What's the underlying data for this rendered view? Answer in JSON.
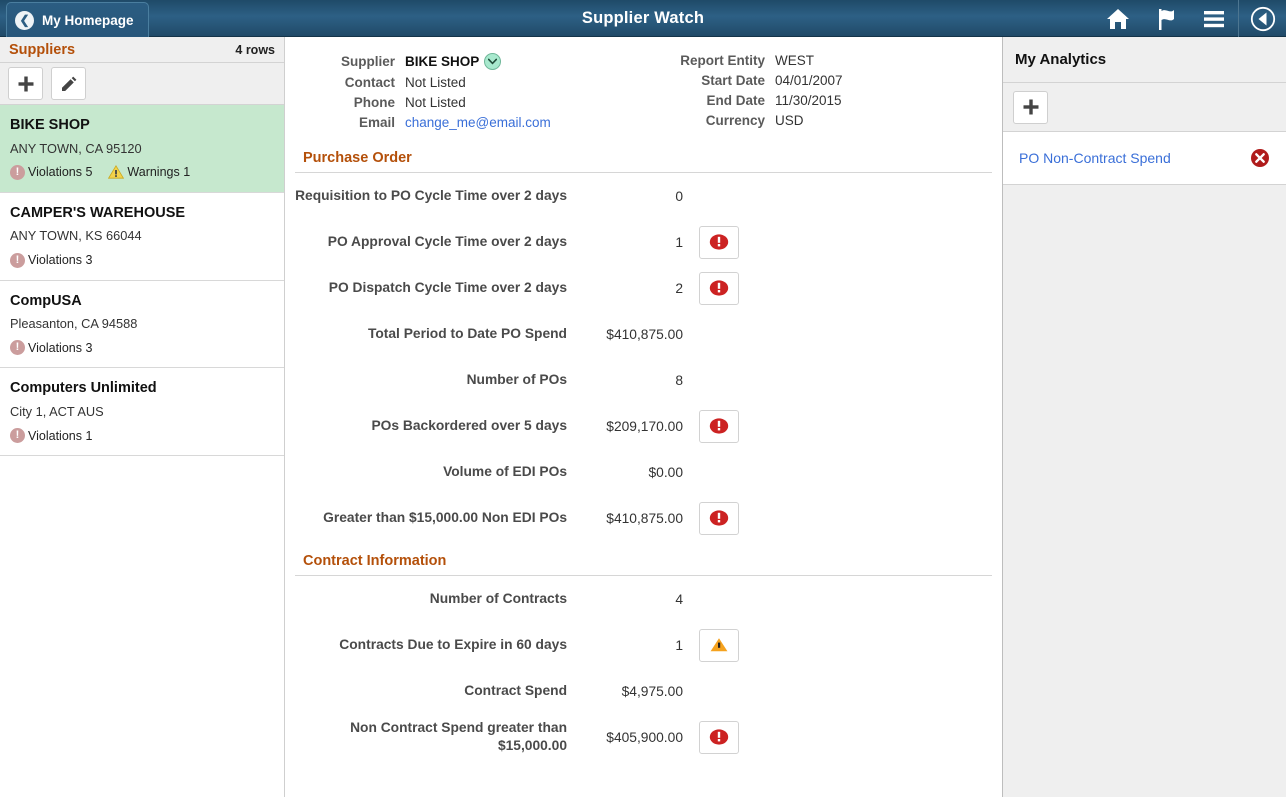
{
  "topbar": {
    "back_label": "My Homepage",
    "back_icon": "chevron-left-icon",
    "title": "Supplier Watch",
    "icons": [
      {
        "name": "home-icon",
        "label": "Home"
      },
      {
        "name": "flag-icon",
        "label": "Notifications"
      },
      {
        "name": "hamburger-menu-icon",
        "label": "Actions Menu"
      },
      {
        "name": "nav-compass-icon",
        "label": "Navigator"
      }
    ]
  },
  "sidebar": {
    "title": "Suppliers",
    "row_count": "4 rows",
    "toolbar": {
      "add_label": "Add",
      "add_icon": "plus-icon",
      "edit_label": "Edit",
      "edit_icon": "pencil-icon"
    },
    "items": [
      {
        "name": "BIKE SHOP",
        "address": "ANY TOWN, CA  95120",
        "violations_label": "Violations 5",
        "warnings_label": "Warnings 1",
        "selected": true
      },
      {
        "name": "CAMPER'S WAREHOUSE",
        "address": "ANY TOWN, KS  66044",
        "violations_label": "Violations 3",
        "warnings_label": "",
        "selected": false
      },
      {
        "name": "CompUSA",
        "address": "Pleasanton, CA  94588",
        "violations_label": "Violations 3",
        "warnings_label": "",
        "selected": false
      },
      {
        "name": "Computers Unlimited",
        "address": "City 1, ACT  AUS",
        "violations_label": "Violations 1",
        "warnings_label": "",
        "selected": false
      }
    ]
  },
  "main": {
    "header_left": [
      {
        "label": "Supplier",
        "value": "BIKE SHOP",
        "has_dropdown": true
      },
      {
        "label": "Contact",
        "value": "Not Listed",
        "has_dropdown": false
      },
      {
        "label": "Phone",
        "value": "Not Listed",
        "has_dropdown": false
      },
      {
        "label": "Email",
        "value": "change_me@email.com",
        "has_dropdown": false,
        "is_link": true
      }
    ],
    "header_right": [
      {
        "label": "Report Entity",
        "value": "WEST"
      },
      {
        "label": "Start Date",
        "value": "04/01/2007"
      },
      {
        "label": "End Date",
        "value": "11/30/2015"
      },
      {
        "label": "Currency",
        "value": "USD"
      }
    ],
    "sections": [
      {
        "title": "Purchase Order",
        "metrics": [
          {
            "label": "Requisition to PO Cycle Time over 2 days",
            "value": "0",
            "alert": "none"
          },
          {
            "label": "PO Approval Cycle Time over 2 days",
            "value": "1",
            "alert": "error"
          },
          {
            "label": "PO Dispatch Cycle Time over 2 days",
            "value": "2",
            "alert": "error"
          },
          {
            "label": "Total Period to Date PO Spend",
            "value": "$410,875.00",
            "alert": "none"
          },
          {
            "label": "Number of POs",
            "value": "8",
            "alert": "none"
          },
          {
            "label": "POs Backordered over 5 days",
            "value": "$209,170.00",
            "alert": "error"
          },
          {
            "label": "Volume of EDI POs",
            "value": "$0.00",
            "alert": "none"
          },
          {
            "label": "Greater than $15,000.00 Non EDI POs",
            "value": "$410,875.00",
            "alert": "error"
          }
        ]
      },
      {
        "title": "Contract Information",
        "metrics": [
          {
            "label": "Number of Contracts",
            "value": "4",
            "alert": "none"
          },
          {
            "label": "Contracts Due to Expire in 60 days",
            "value": "1",
            "alert": "warning"
          },
          {
            "label": "Contract Spend",
            "value": "$4,975.00",
            "alert": "none"
          },
          {
            "label": "Non Contract Spend greater than $15,000.00",
            "value": "$405,900.00",
            "alert": "error"
          }
        ]
      }
    ]
  },
  "right_panel": {
    "title": "My Analytics",
    "add_icon": "plus-icon",
    "add_label": "Add Analytic",
    "items": [
      {
        "label": "PO Non-Contract Spend",
        "delete_icon": "delete-circle-icon"
      }
    ]
  },
  "colors": {
    "header_blue": "#2d6085",
    "accent_orange": "#b4500a",
    "link_blue": "#3a6fd8",
    "selected_green": "#c6e8ce",
    "error_red": "#cc2222",
    "warning_orange": "#f5a21e",
    "violation_rose": "#cb9d9d",
    "panel_gray": "#efefef"
  }
}
